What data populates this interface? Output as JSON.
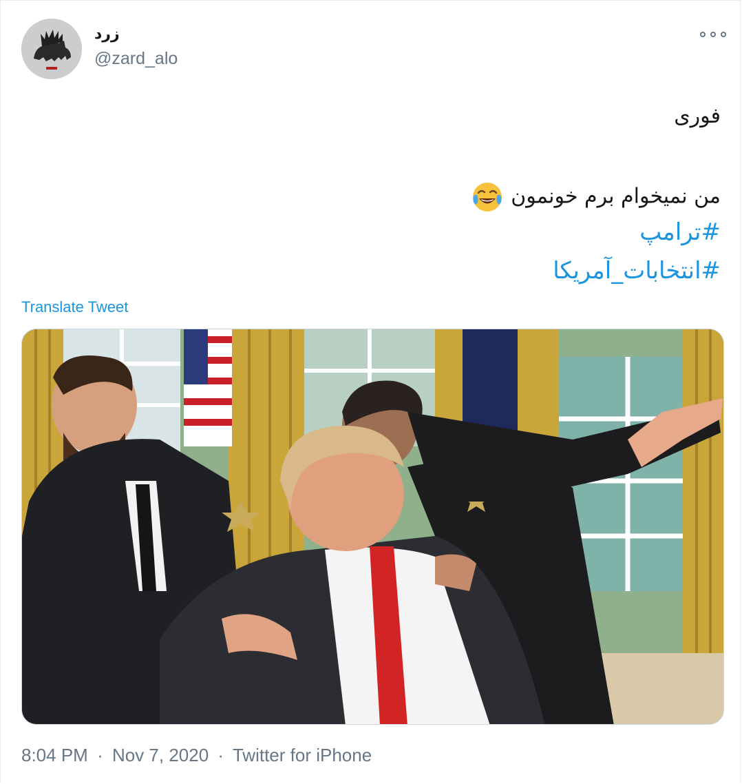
{
  "user": {
    "display_name": "زرد",
    "handle": "@zard_alo",
    "avatar_icon": "bear-avatar-icon"
  },
  "menu": {
    "more_icon": "more-horizontal-icon"
  },
  "tweet": {
    "line1": "فوری",
    "line2": "من نمیخوام برم خونمون",
    "emoji": "face-with-tears-of-joy",
    "hashtags": [
      "#ترامپ",
      "#انتخابات_آمریکا"
    ]
  },
  "translate_label": "Translate Tweet",
  "meta": {
    "time": "8:04 PM",
    "separator": "·",
    "date": "Nov 7, 2020",
    "source": "Twitter for iPhone"
  },
  "colors": {
    "link": "#1b95e0",
    "secondary_text": "#657786",
    "primary_text": "#14171a",
    "curtain_gold": "#c9a53a",
    "tie_red": "#d22424"
  }
}
